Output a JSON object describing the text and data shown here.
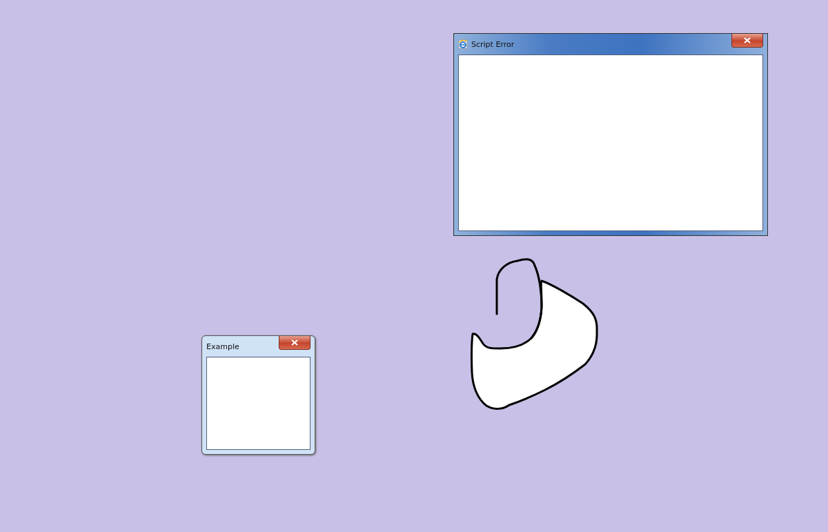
{
  "windows": [
    {
      "title": "Script Error",
      "active": true,
      "has_app_icon": true
    },
    {
      "title": "Example",
      "active": false,
      "has_app_icon": false
    }
  ]
}
